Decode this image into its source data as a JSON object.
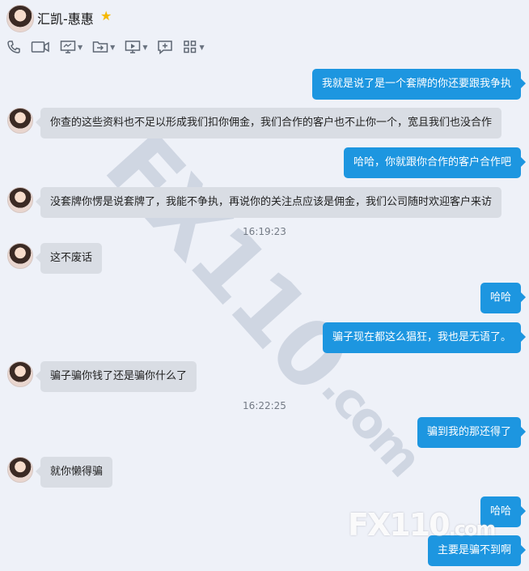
{
  "contact": {
    "name": "汇凯-惠惠",
    "star_icon": "star-icon"
  },
  "toolbar": {
    "icons": [
      "phone-icon",
      "video-icon",
      "screen-share-icon",
      "file-transfer-icon",
      "remote-desktop-icon",
      "add-chat-icon",
      "apps-icon"
    ]
  },
  "messages": [
    {
      "side": "out",
      "text": "我就是说了是一个套牌的你还要跟我争执"
    },
    {
      "side": "in",
      "text": "你查的这些资料也不足以形成我们扣你佣金，我们合作的客户也不止你一个，宽且我们也没合作"
    },
    {
      "side": "out",
      "text": "哈哈，你就跟你合作的客户合作吧"
    },
    {
      "side": "in",
      "text": "没套牌你愣是说套牌了，我能不争执，再说你的关注点应该是佣金，我们公司随时欢迎客户来访"
    },
    {
      "side": "time",
      "text": "16:19:23"
    },
    {
      "side": "in",
      "text": "这不废话"
    },
    {
      "side": "out",
      "text": "哈哈"
    },
    {
      "side": "out",
      "text": "骗子现在都这么猖狂，我也是无语了。"
    },
    {
      "side": "in",
      "text": "骗子骗你钱了还是骗你什么了"
    },
    {
      "side": "time",
      "text": "16:22:25"
    },
    {
      "side": "out",
      "text": "骗到我的那还得了"
    },
    {
      "side": "in",
      "text": "就你懒得骗"
    },
    {
      "side": "out",
      "text": "哈哈"
    },
    {
      "side": "out",
      "text": "主要是骗不到啊"
    }
  ],
  "watermark": {
    "main": "FX110",
    "suffix": ".com"
  },
  "colors": {
    "incoming": "#d9dde4",
    "outgoing": "#1d96e0",
    "background": "#eef1f8",
    "star": "#f5b800"
  }
}
